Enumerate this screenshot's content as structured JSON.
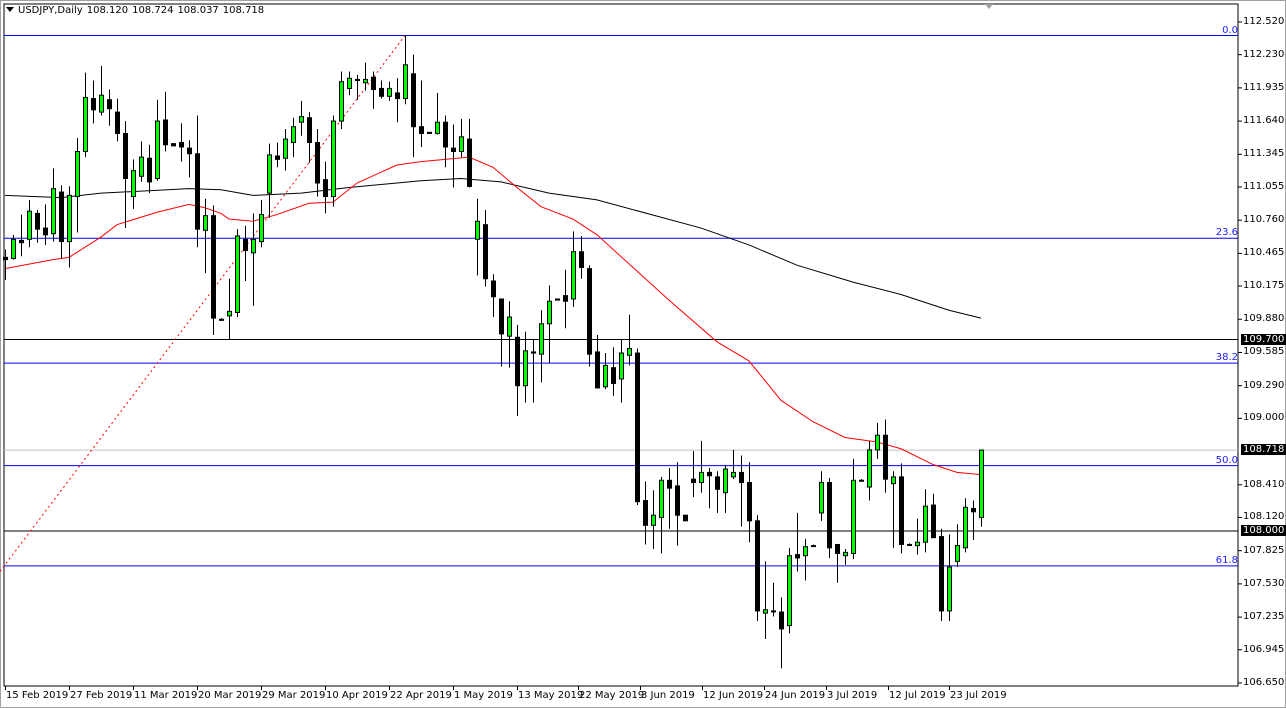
{
  "header": {
    "symbol": "USDJPY,Daily",
    "open": "108.120",
    "high": "108.724",
    "low": "108.037",
    "close": "108.718"
  },
  "colors": {
    "bull": "#00ff00",
    "bear": "#000000",
    "ma_fast": "#ff0000",
    "ma_slow": "#000000",
    "fib": "#0000ff",
    "fib_trend": "#ff0000",
    "level": "#000000",
    "bid_line": "#c0c0c0"
  },
  "price_axis": [
    "112.520",
    "112.230",
    "111.935",
    "111.640",
    "111.345",
    "111.055",
    "110.760",
    "110.465",
    "110.175",
    "109.880",
    "109.585",
    "109.290",
    "109.000",
    "108.410",
    "108.120",
    "107.825",
    "107.530",
    "107.235",
    "106.945",
    "106.650"
  ],
  "highlighted_prices": [
    {
      "label": "109.700",
      "value": 109.7
    },
    {
      "label": "108.000",
      "value": 108.0
    },
    {
      "label": "108.718",
      "value": 108.718
    }
  ],
  "date_axis": [
    "15 Feb 2019",
    "27 Feb 2019",
    "11 Mar 2019",
    "20 Mar 2019",
    "29 Mar 2019",
    "10 Apr 2019",
    "22 Apr 2019",
    "1 May 2019",
    "13 May 2019",
    "22 May 2019",
    "3 Jun 2019",
    "12 Jun 2019",
    "24 Jun 2019",
    "3 Jul 2019",
    "12 Jul 2019",
    "23 Jul 2019"
  ],
  "fib_levels": [
    {
      "label": "0.0",
      "price": 112.4
    },
    {
      "label": "23.6",
      "price": 110.6
    },
    {
      "label": "38.2",
      "price": 109.49
    },
    {
      "label": "50.0",
      "price": 108.58
    },
    {
      "label": "61.8",
      "price": 107.69
    }
  ],
  "horizontal_levels": [
    109.7,
    108.0
  ],
  "bid_price": 108.718,
  "chart_data": {
    "type": "candlestick",
    "title": "USDJPY,Daily",
    "ylim": [
      106.65,
      112.52
    ],
    "ohlc": [
      [
        110.43,
        110.5,
        110.23,
        110.41
      ],
      [
        110.42,
        110.63,
        110.41,
        110.59
      ],
      [
        110.58,
        110.81,
        110.44,
        110.56
      ],
      [
        110.59,
        110.94,
        110.52,
        110.84
      ],
      [
        110.82,
        110.85,
        110.56,
        110.68
      ],
      [
        110.69,
        110.9,
        110.54,
        110.63
      ],
      [
        110.64,
        111.22,
        110.57,
        111.04
      ],
      [
        111.01,
        111.07,
        110.42,
        110.57
      ],
      [
        110.57,
        111.06,
        110.34,
        110.98
      ],
      [
        110.97,
        111.49,
        110.65,
        111.37
      ],
      [
        111.37,
        112.07,
        111.32,
        111.85
      ],
      [
        111.84,
        112.0,
        111.62,
        111.74
      ],
      [
        111.72,
        112.13,
        111.69,
        111.87
      ],
      [
        111.83,
        111.92,
        111.6,
        111.75
      ],
      [
        111.72,
        111.84,
        111.46,
        111.53
      ],
      [
        111.53,
        111.64,
        110.69,
        111.13
      ],
      [
        110.97,
        111.3,
        110.86,
        111.2
      ],
      [
        111.15,
        111.46,
        111.1,
        111.32
      ],
      [
        111.31,
        111.43,
        111.0,
        111.1
      ],
      [
        111.13,
        111.83,
        111.11,
        111.64
      ],
      [
        111.65,
        111.9,
        111.37,
        111.43
      ],
      [
        111.44,
        111.44,
        111.42,
        111.42
      ],
      [
        111.45,
        111.62,
        111.28,
        111.41
      ],
      [
        111.4,
        111.47,
        111.14,
        111.35
      ],
      [
        111.35,
        111.69,
        110.52,
        110.68
      ],
      [
        110.67,
        110.95,
        110.29,
        110.8
      ],
      [
        110.8,
        110.89,
        109.74,
        109.89
      ],
      [
        109.88,
        109.89,
        109.87,
        109.87
      ],
      [
        109.91,
        110.24,
        109.7,
        109.95
      ],
      [
        109.94,
        110.68,
        109.9,
        110.62
      ],
      [
        110.59,
        110.71,
        110.22,
        110.49
      ],
      [
        110.47,
        110.82,
        110.0,
        110.59
      ],
      [
        110.57,
        110.94,
        110.52,
        110.81
      ],
      [
        111.0,
        111.44,
        110.78,
        111.34
      ],
      [
        111.33,
        111.45,
        111.23,
        111.3
      ],
      [
        111.31,
        111.57,
        111.2,
        111.48
      ],
      [
        111.45,
        111.67,
        111.32,
        111.59
      ],
      [
        111.63,
        111.82,
        111.51,
        111.68
      ],
      [
        111.67,
        111.72,
        111.27,
        111.45
      ],
      [
        111.45,
        111.57,
        110.97,
        111.09
      ],
      [
        111.12,
        111.28,
        110.82,
        110.97
      ],
      [
        110.97,
        111.69,
        110.88,
        111.64
      ],
      [
        111.64,
        112.08,
        111.57,
        111.99
      ],
      [
        111.93,
        112.08,
        111.87,
        112.02
      ],
      [
        112.01,
        112.05,
        111.83,
        112.0
      ],
      [
        111.98,
        112.16,
        111.91,
        112.01
      ],
      [
        112.03,
        112.08,
        111.75,
        111.92
      ],
      [
        111.93,
        112.0,
        111.84,
        111.86
      ],
      [
        111.86,
        111.99,
        111.82,
        111.93
      ],
      [
        111.89,
        112.02,
        111.63,
        111.84
      ],
      [
        111.84,
        112.4,
        111.79,
        112.14
      ],
      [
        112.06,
        112.23,
        111.32,
        111.59
      ],
      [
        111.59,
        112.0,
        111.41,
        111.53
      ],
      [
        111.54,
        111.54,
        111.53,
        111.53
      ],
      [
        111.53,
        111.89,
        111.52,
        111.63
      ],
      [
        111.63,
        111.69,
        111.23,
        111.41
      ],
      [
        111.4,
        111.61,
        111.05,
        111.37
      ],
      [
        111.37,
        111.66,
        111.32,
        111.5
      ],
      [
        111.48,
        111.66,
        111.05,
        111.06
      ],
      [
        110.59,
        110.95,
        110.27,
        110.75
      ],
      [
        110.72,
        110.85,
        110.17,
        110.24
      ],
      [
        110.22,
        110.28,
        109.9,
        110.08
      ],
      [
        110.06,
        110.06,
        109.46,
        109.75
      ],
      [
        109.73,
        110.04,
        109.45,
        109.9
      ],
      [
        109.72,
        109.83,
        109.02,
        109.29
      ],
      [
        109.29,
        109.77,
        109.14,
        109.6
      ],
      [
        109.59,
        109.7,
        109.14,
        109.58
      ],
      [
        109.57,
        109.96,
        109.32,
        109.84
      ],
      [
        109.84,
        110.18,
        109.49,
        110.04
      ],
      [
        110.06,
        110.06,
        110.05,
        110.05
      ],
      [
        110.09,
        110.32,
        109.8,
        110.04
      ],
      [
        110.06,
        110.66,
        109.99,
        110.48
      ],
      [
        110.48,
        110.62,
        110.24,
        110.34
      ],
      [
        110.33,
        110.36,
        109.46,
        109.57
      ],
      [
        109.59,
        109.74,
        109.27,
        109.27
      ],
      [
        109.28,
        109.58,
        109.26,
        109.47
      ],
      [
        109.45,
        109.63,
        109.2,
        109.31
      ],
      [
        109.35,
        109.7,
        109.14,
        109.58
      ],
      [
        109.56,
        109.92,
        109.47,
        109.62
      ],
      [
        109.58,
        109.62,
        108.23,
        108.26
      ],
      [
        108.27,
        108.44,
        107.88,
        108.05
      ],
      [
        108.05,
        108.36,
        107.84,
        108.14
      ],
      [
        108.12,
        108.48,
        107.8,
        108.45
      ],
      [
        108.45,
        108.56,
        108.02,
        108.38
      ],
      [
        108.4,
        108.61,
        107.87,
        108.14
      ],
      [
        108.14,
        108.14,
        108.09,
        108.09
      ],
      [
        108.46,
        108.71,
        108.3,
        108.43
      ],
      [
        108.43,
        108.8,
        108.34,
        108.52
      ],
      [
        108.52,
        108.56,
        108.2,
        108.49
      ],
      [
        108.48,
        108.53,
        108.16,
        108.37
      ],
      [
        108.34,
        108.58,
        108.16,
        108.55
      ],
      [
        108.48,
        108.72,
        108.46,
        108.52
      ],
      [
        108.52,
        108.67,
        108.04,
        108.43
      ],
      [
        108.43,
        108.61,
        107.9,
        108.09
      ],
      [
        108.09,
        108.14,
        107.2,
        107.29
      ],
      [
        107.27,
        107.73,
        107.04,
        107.3
      ],
      [
        107.29,
        107.54,
        107.24,
        107.29
      ],
      [
        107.28,
        107.41,
        106.78,
        107.13
      ],
      [
        107.16,
        107.85,
        107.09,
        107.78
      ],
      [
        107.79,
        108.16,
        107.64,
        107.76
      ],
      [
        107.78,
        107.93,
        107.56,
        107.86
      ],
      [
        107.87,
        107.88,
        107.86,
        107.87
      ],
      [
        108.16,
        108.53,
        108.09,
        108.43
      ],
      [
        108.43,
        108.47,
        107.76,
        107.85
      ],
      [
        107.88,
        107.88,
        107.54,
        107.8
      ],
      [
        107.78,
        107.84,
        107.7,
        107.81
      ],
      [
        107.8,
        108.64,
        107.75,
        108.45
      ],
      [
        108.45,
        108.46,
        108.44,
        108.45
      ],
      [
        108.39,
        108.8,
        108.27,
        108.72
      ],
      [
        108.72,
        108.96,
        108.64,
        108.85
      ],
      [
        108.85,
        108.99,
        108.34,
        108.46
      ],
      [
        108.42,
        108.53,
        107.85,
        108.48
      ],
      [
        108.48,
        108.6,
        107.8,
        107.88
      ],
      [
        107.88,
        107.89,
        107.87,
        107.88
      ],
      [
        107.87,
        108.11,
        107.79,
        107.9
      ],
      [
        107.9,
        108.37,
        107.81,
        108.22
      ],
      [
        108.23,
        108.33,
        107.94,
        107.94
      ],
      [
        107.95,
        108.02,
        107.2,
        107.29
      ],
      [
        107.29,
        107.97,
        107.2,
        107.68
      ],
      [
        107.73,
        108.06,
        107.68,
        107.87
      ],
      [
        107.85,
        108.29,
        107.81,
        108.21
      ],
      [
        108.2,
        108.27,
        107.92,
        108.17
      ],
      [
        108.12,
        108.724,
        108.037,
        108.718
      ]
    ],
    "ma_fast": [
      [
        0,
        110.33
      ],
      [
        6,
        110.41
      ],
      [
        8,
        110.43
      ],
      [
        12,
        110.61
      ],
      [
        14,
        110.72
      ],
      [
        19,
        110.83
      ],
      [
        23,
        110.9
      ],
      [
        25,
        110.87
      ],
      [
        27,
        110.82
      ],
      [
        28,
        110.77
      ],
      [
        31,
        110.75
      ],
      [
        34,
        110.81
      ],
      [
        38,
        110.91
      ],
      [
        41,
        110.92
      ],
      [
        44,
        111.09
      ],
      [
        49,
        111.25
      ],
      [
        52,
        111.28
      ],
      [
        58,
        111.32
      ],
      [
        61,
        111.23
      ],
      [
        64,
        111.05
      ],
      [
        67,
        110.88
      ],
      [
        71,
        110.77
      ],
      [
        74,
        110.63
      ],
      [
        83,
        110.05
      ],
      [
        89,
        109.68
      ],
      [
        93,
        109.51
      ],
      [
        97,
        109.16
      ],
      [
        101,
        108.97
      ],
      [
        105,
        108.83
      ],
      [
        109,
        108.79
      ],
      [
        112,
        108.73
      ],
      [
        116,
        108.59
      ],
      [
        119,
        108.52
      ],
      [
        122,
        108.5
      ]
    ],
    "ma_slow": [
      [
        0,
        110.98
      ],
      [
        7,
        110.96
      ],
      [
        12,
        111.0
      ],
      [
        23,
        111.04
      ],
      [
        27,
        111.03
      ],
      [
        31,
        110.98
      ],
      [
        37,
        111.0
      ],
      [
        43,
        111.05
      ],
      [
        52,
        111.11
      ],
      [
        57,
        111.13
      ],
      [
        62,
        111.1
      ],
      [
        68,
        111.0
      ],
      [
        74,
        110.94
      ],
      [
        87,
        110.69
      ],
      [
        93,
        110.54
      ],
      [
        99,
        110.36
      ],
      [
        106,
        110.21
      ],
      [
        112,
        110.1
      ],
      [
        118,
        109.96
      ],
      [
        122,
        109.89
      ]
    ],
    "fib_trendline": [
      [
        0,
        107.7
      ],
      [
        50,
        112.4
      ]
    ]
  }
}
